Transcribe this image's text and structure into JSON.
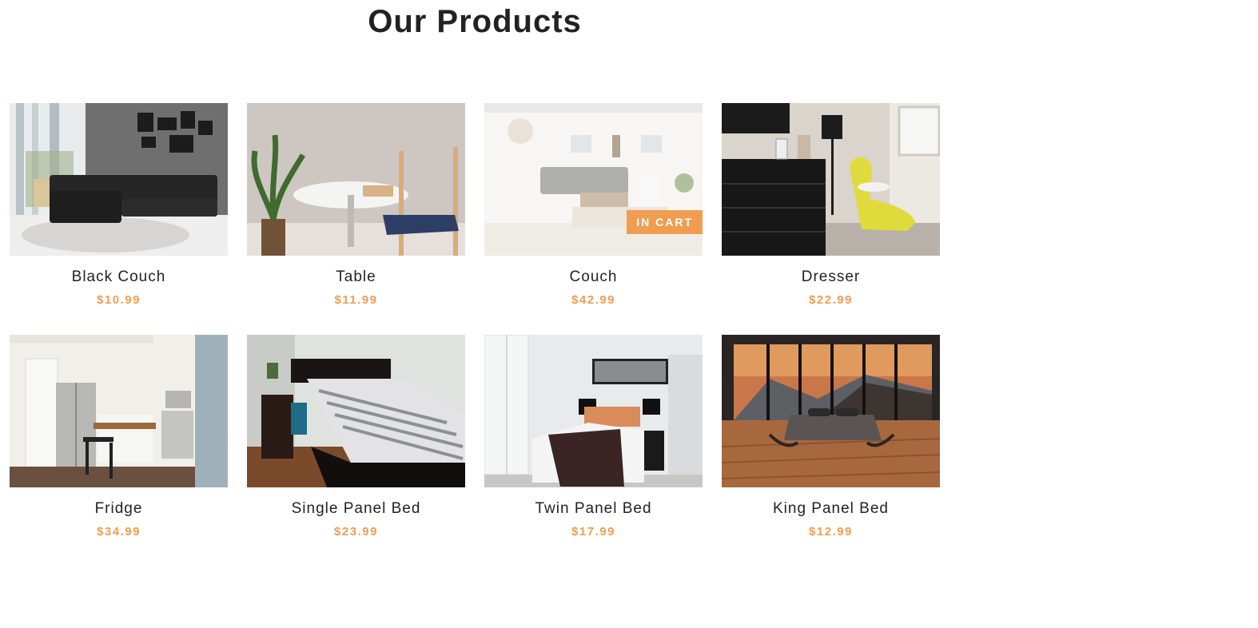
{
  "section": {
    "title": "Our Products"
  },
  "colors": {
    "accent": "#f09d51",
    "text": "#222222"
  },
  "products": [
    {
      "name": "Black Couch",
      "price": "$10.99",
      "in_cart": false,
      "badge": ""
    },
    {
      "name": "Table",
      "price": "$11.99",
      "in_cart": false,
      "badge": ""
    },
    {
      "name": "Couch",
      "price": "$42.99",
      "in_cart": true,
      "badge": "IN CART"
    },
    {
      "name": "Dresser",
      "price": "$22.99",
      "in_cart": false,
      "badge": ""
    },
    {
      "name": "Fridge",
      "price": "$34.99",
      "in_cart": false,
      "badge": ""
    },
    {
      "name": "Single Panel Bed",
      "price": "$23.99",
      "in_cart": false,
      "badge": ""
    },
    {
      "name": "Twin Panel Bed",
      "price": "$17.99",
      "in_cart": false,
      "badge": ""
    },
    {
      "name": "King Panel Bed",
      "price": "$12.99",
      "in_cart": false,
      "badge": ""
    }
  ]
}
